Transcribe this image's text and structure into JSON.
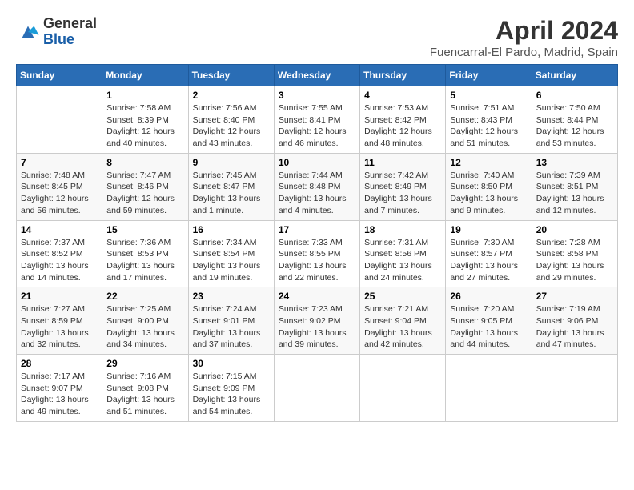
{
  "header": {
    "logo_general": "General",
    "logo_blue": "Blue",
    "title": "April 2024",
    "subtitle": "Fuencarral-El Pardo, Madrid, Spain"
  },
  "weekdays": [
    "Sunday",
    "Monday",
    "Tuesday",
    "Wednesday",
    "Thursday",
    "Friday",
    "Saturday"
  ],
  "weeks": [
    [
      {
        "num": "",
        "sunrise": "",
        "sunset": "",
        "daylight": ""
      },
      {
        "num": "1",
        "sunrise": "Sunrise: 7:58 AM",
        "sunset": "Sunset: 8:39 PM",
        "daylight": "Daylight: 12 hours and 40 minutes."
      },
      {
        "num": "2",
        "sunrise": "Sunrise: 7:56 AM",
        "sunset": "Sunset: 8:40 PM",
        "daylight": "Daylight: 12 hours and 43 minutes."
      },
      {
        "num": "3",
        "sunrise": "Sunrise: 7:55 AM",
        "sunset": "Sunset: 8:41 PM",
        "daylight": "Daylight: 12 hours and 46 minutes."
      },
      {
        "num": "4",
        "sunrise": "Sunrise: 7:53 AM",
        "sunset": "Sunset: 8:42 PM",
        "daylight": "Daylight: 12 hours and 48 minutes."
      },
      {
        "num": "5",
        "sunrise": "Sunrise: 7:51 AM",
        "sunset": "Sunset: 8:43 PM",
        "daylight": "Daylight: 12 hours and 51 minutes."
      },
      {
        "num": "6",
        "sunrise": "Sunrise: 7:50 AM",
        "sunset": "Sunset: 8:44 PM",
        "daylight": "Daylight: 12 hours and 53 minutes."
      }
    ],
    [
      {
        "num": "7",
        "sunrise": "Sunrise: 7:48 AM",
        "sunset": "Sunset: 8:45 PM",
        "daylight": "Daylight: 12 hours and 56 minutes."
      },
      {
        "num": "8",
        "sunrise": "Sunrise: 7:47 AM",
        "sunset": "Sunset: 8:46 PM",
        "daylight": "Daylight: 12 hours and 59 minutes."
      },
      {
        "num": "9",
        "sunrise": "Sunrise: 7:45 AM",
        "sunset": "Sunset: 8:47 PM",
        "daylight": "Daylight: 13 hours and 1 minute."
      },
      {
        "num": "10",
        "sunrise": "Sunrise: 7:44 AM",
        "sunset": "Sunset: 8:48 PM",
        "daylight": "Daylight: 13 hours and 4 minutes."
      },
      {
        "num": "11",
        "sunrise": "Sunrise: 7:42 AM",
        "sunset": "Sunset: 8:49 PM",
        "daylight": "Daylight: 13 hours and 7 minutes."
      },
      {
        "num": "12",
        "sunrise": "Sunrise: 7:40 AM",
        "sunset": "Sunset: 8:50 PM",
        "daylight": "Daylight: 13 hours and 9 minutes."
      },
      {
        "num": "13",
        "sunrise": "Sunrise: 7:39 AM",
        "sunset": "Sunset: 8:51 PM",
        "daylight": "Daylight: 13 hours and 12 minutes."
      }
    ],
    [
      {
        "num": "14",
        "sunrise": "Sunrise: 7:37 AM",
        "sunset": "Sunset: 8:52 PM",
        "daylight": "Daylight: 13 hours and 14 minutes."
      },
      {
        "num": "15",
        "sunrise": "Sunrise: 7:36 AM",
        "sunset": "Sunset: 8:53 PM",
        "daylight": "Daylight: 13 hours and 17 minutes."
      },
      {
        "num": "16",
        "sunrise": "Sunrise: 7:34 AM",
        "sunset": "Sunset: 8:54 PM",
        "daylight": "Daylight: 13 hours and 19 minutes."
      },
      {
        "num": "17",
        "sunrise": "Sunrise: 7:33 AM",
        "sunset": "Sunset: 8:55 PM",
        "daylight": "Daylight: 13 hours and 22 minutes."
      },
      {
        "num": "18",
        "sunrise": "Sunrise: 7:31 AM",
        "sunset": "Sunset: 8:56 PM",
        "daylight": "Daylight: 13 hours and 24 minutes."
      },
      {
        "num": "19",
        "sunrise": "Sunrise: 7:30 AM",
        "sunset": "Sunset: 8:57 PM",
        "daylight": "Daylight: 13 hours and 27 minutes."
      },
      {
        "num": "20",
        "sunrise": "Sunrise: 7:28 AM",
        "sunset": "Sunset: 8:58 PM",
        "daylight": "Daylight: 13 hours and 29 minutes."
      }
    ],
    [
      {
        "num": "21",
        "sunrise": "Sunrise: 7:27 AM",
        "sunset": "Sunset: 8:59 PM",
        "daylight": "Daylight: 13 hours and 32 minutes."
      },
      {
        "num": "22",
        "sunrise": "Sunrise: 7:25 AM",
        "sunset": "Sunset: 9:00 PM",
        "daylight": "Daylight: 13 hours and 34 minutes."
      },
      {
        "num": "23",
        "sunrise": "Sunrise: 7:24 AM",
        "sunset": "Sunset: 9:01 PM",
        "daylight": "Daylight: 13 hours and 37 minutes."
      },
      {
        "num": "24",
        "sunrise": "Sunrise: 7:23 AM",
        "sunset": "Sunset: 9:02 PM",
        "daylight": "Daylight: 13 hours and 39 minutes."
      },
      {
        "num": "25",
        "sunrise": "Sunrise: 7:21 AM",
        "sunset": "Sunset: 9:04 PM",
        "daylight": "Daylight: 13 hours and 42 minutes."
      },
      {
        "num": "26",
        "sunrise": "Sunrise: 7:20 AM",
        "sunset": "Sunset: 9:05 PM",
        "daylight": "Daylight: 13 hours and 44 minutes."
      },
      {
        "num": "27",
        "sunrise": "Sunrise: 7:19 AM",
        "sunset": "Sunset: 9:06 PM",
        "daylight": "Daylight: 13 hours and 47 minutes."
      }
    ],
    [
      {
        "num": "28",
        "sunrise": "Sunrise: 7:17 AM",
        "sunset": "Sunset: 9:07 PM",
        "daylight": "Daylight: 13 hours and 49 minutes."
      },
      {
        "num": "29",
        "sunrise": "Sunrise: 7:16 AM",
        "sunset": "Sunset: 9:08 PM",
        "daylight": "Daylight: 13 hours and 51 minutes."
      },
      {
        "num": "30",
        "sunrise": "Sunrise: 7:15 AM",
        "sunset": "Sunset: 9:09 PM",
        "daylight": "Daylight: 13 hours and 54 minutes."
      },
      {
        "num": "",
        "sunrise": "",
        "sunset": "",
        "daylight": ""
      },
      {
        "num": "",
        "sunrise": "",
        "sunset": "",
        "daylight": ""
      },
      {
        "num": "",
        "sunrise": "",
        "sunset": "",
        "daylight": ""
      },
      {
        "num": "",
        "sunrise": "",
        "sunset": "",
        "daylight": ""
      }
    ]
  ]
}
